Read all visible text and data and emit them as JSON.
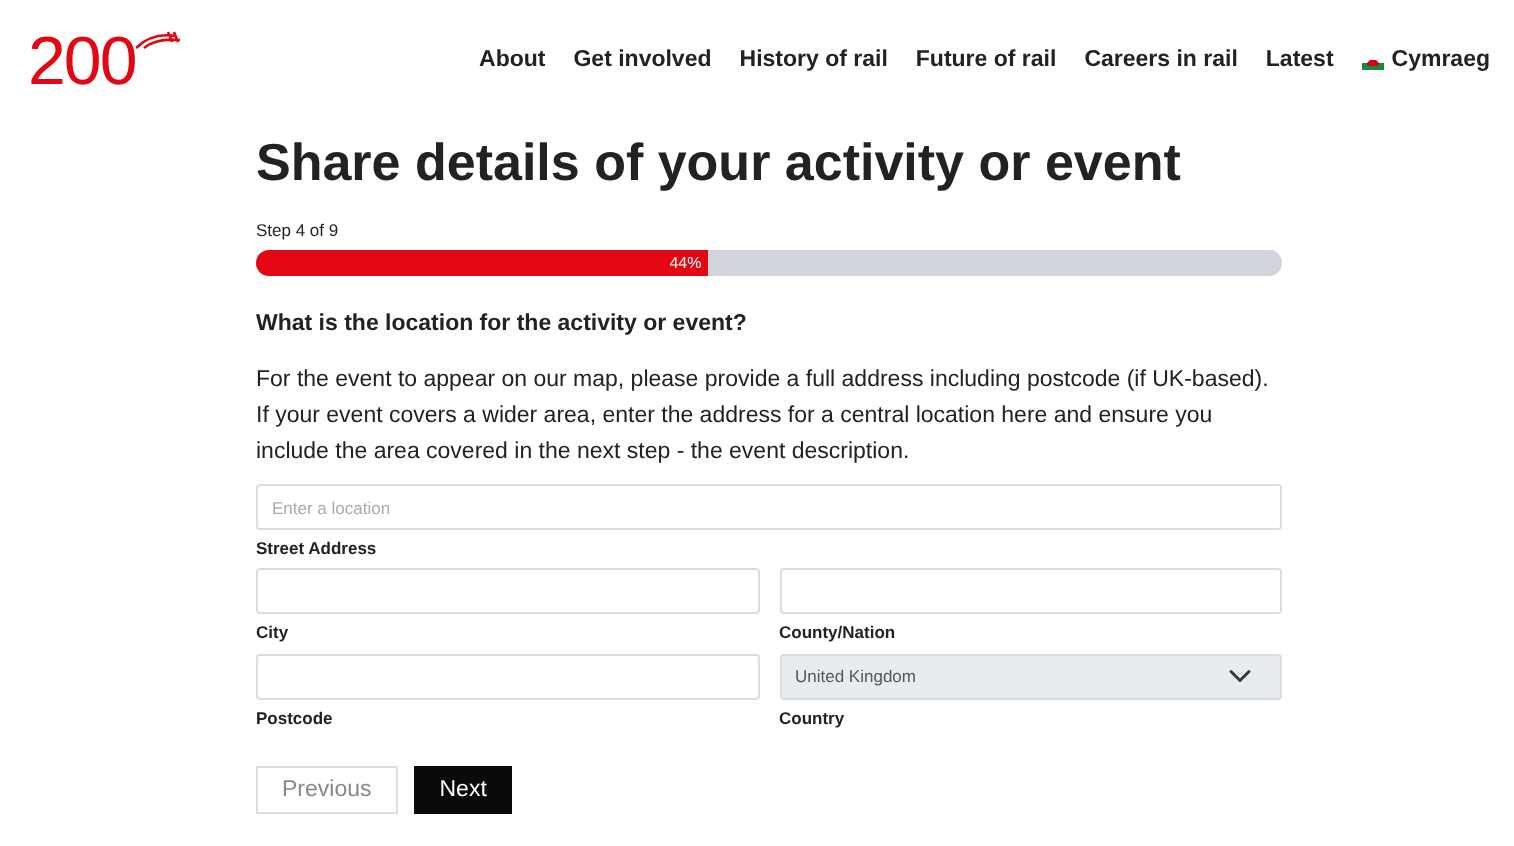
{
  "logo": {
    "text": "200"
  },
  "nav": [
    {
      "label": "About"
    },
    {
      "label": "Get involved"
    },
    {
      "label": "History of rail"
    },
    {
      "label": "Future of rail"
    },
    {
      "label": "Careers in rail"
    },
    {
      "label": "Latest"
    },
    {
      "label": "Cymraeg",
      "kind": "language"
    }
  ],
  "title": "Share details of your activity or event",
  "progress": {
    "step": "Step 4 of 9",
    "level": 0.44,
    "reading": "44%"
  },
  "question": "What is the location for the activity or event?",
  "description": "For the event to appear on our map, please provide a full address including postcode (if UK-based). If your event covers a wider area, enter the address for a central location here and ensure you include the area covered in the next step - the event description.",
  "location": {
    "placeholder": "Enter a location",
    "label": "Street Address"
  },
  "field_rows": [
    {
      "fields": [
        {
          "kind": "input",
          "label": "City",
          "disabled": false
        },
        {
          "kind": "input",
          "label": "County/Nation",
          "disabled": false
        }
      ]
    },
    {
      "fields": [
        {
          "kind": "input",
          "label": "Postcode",
          "disabled": false
        },
        {
          "kind": "select",
          "label": "Country",
          "value": "United Kingdom",
          "disabled": true
        }
      ]
    }
  ],
  "buttons": [
    {
      "label": "Previous",
      "kind": "secondary"
    },
    {
      "label": "Next",
      "kind": "primary"
    }
  ]
}
